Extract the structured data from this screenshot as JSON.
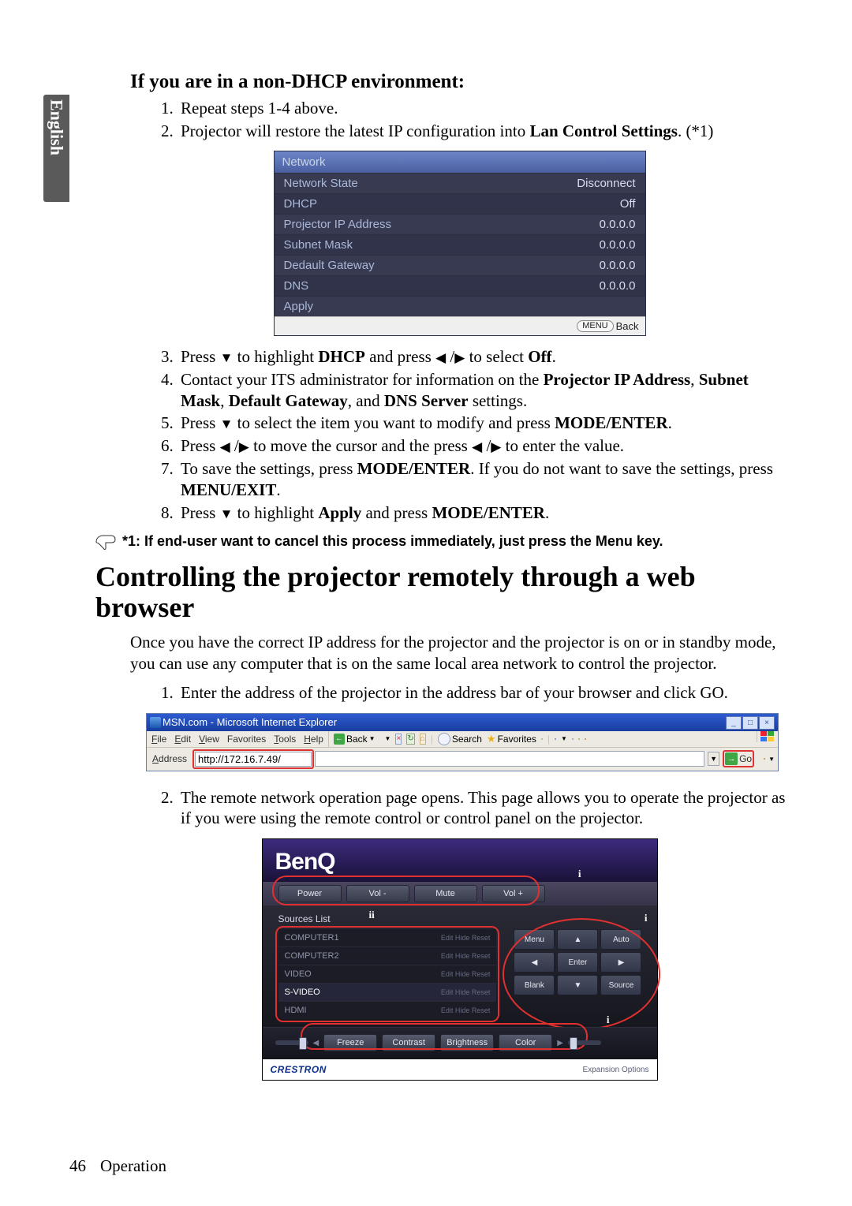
{
  "sidebar_language": "English",
  "section_nondhcp_title": "If you are in a non-DHCP environment:",
  "steps_a": {
    "s1": "Repeat steps 1-4 above.",
    "s2_pre": "Projector will restore the latest IP configuration into ",
    "s2_bold": "Lan Control Settings",
    "s2_post": ". (*1)"
  },
  "net_panel": {
    "title": "Network",
    "rows": [
      {
        "label": "Network State",
        "value": "Disconnect"
      },
      {
        "label": "DHCP",
        "value": "Off"
      },
      {
        "label": "Projector IP Address",
        "value": "0.0.0.0"
      },
      {
        "label": "Subnet Mask",
        "value": "0.0.0.0"
      },
      {
        "label": "Dedault Gateway",
        "value": "0.0.0.0"
      },
      {
        "label": "DNS",
        "value": "0.0.0.0"
      },
      {
        "label": "Apply",
        "value": ""
      }
    ],
    "footer_btn": "MENU",
    "footer_text": "Back"
  },
  "steps_b": {
    "s3_a": "Press ",
    "s3_b": " to highlight ",
    "s3_bold1": "DHCP",
    "s3_c": " and press ",
    "s3_d": " to select ",
    "s3_bold2": "Off",
    "s3_e": ".",
    "s4_a": "Contact your ITS administrator for information on the ",
    "s4_b1": "Projector IP Address",
    "s4_c": ", ",
    "s4_b2": "Subnet Mask",
    "s4_d": ", ",
    "s4_b3": "Default Gateway",
    "s4_e": ", and ",
    "s4_b4": "DNS Server",
    "s4_f": " settings.",
    "s5_a": "Press ",
    "s5_b": " to select the item you want to modify and press ",
    "s5_bold": "MODE/ENTER",
    "s5_c": ".",
    "s6_a": "Press ",
    "s6_b": " to move the cursor and the press ",
    "s6_c": " to enter the value.",
    "s7_a": "To save the settings, press ",
    "s7_b1": "MODE/ENTER",
    "s7_b": ". If you do not want to save the settings, press ",
    "s7_b2": "MENU/EXIT",
    "s7_c": ".",
    "s8_a": "Press ",
    "s8_b": " to highlight ",
    "s8_bold1": "Apply",
    "s8_c": " and press ",
    "s8_bold2": "MODE/ENTER",
    "s8_d": "."
  },
  "note_text": "*1: If end-user want to cancel this process immediately, just press the Menu key.",
  "h2_title": "Controlling the projector remotely through a web browser",
  "intro_para": "Once you have the correct IP address for the projector and the projector is on or in standby mode, you can use any computer that is on the same local area network to control the projector.",
  "steps_c": {
    "s1": "Enter the address of the projector in the address bar of your browser and click GO.",
    "s2": "The remote network operation page opens. This page allows you to operate the projector as if you were using the remote control or control panel on the projector."
  },
  "ie": {
    "title": "MSN.com - Microsoft Internet Explorer",
    "menus": [
      "File",
      "Edit",
      "View",
      "Favorites",
      "Tools",
      "Help"
    ],
    "back": "Back",
    "search": "Search",
    "favorites": "Favorites",
    "addr_label": "Address",
    "url": "http://172.16.7.49/",
    "go": "Go"
  },
  "benq": {
    "logo": "BenQ",
    "top_buttons": [
      "Power",
      "Vol -",
      "Mute",
      "Vol +"
    ],
    "sources_title": "Sources List",
    "sources": [
      {
        "name": "COMPUTER1",
        "acts": "Edit   Hide   Reset"
      },
      {
        "name": "COMPUTER2",
        "acts": "Edit   Hide   Reset"
      },
      {
        "name": "VIDEO",
        "acts": "Edit   Hide   Reset"
      },
      {
        "name": "S-VIDEO",
        "acts": "Edit   Hide   Reset",
        "sel": true
      },
      {
        "name": "HDMI",
        "acts": "Edit   Hide   Reset"
      }
    ],
    "dpad": {
      "menu": "Menu",
      "auto": "Auto",
      "enter": "Enter",
      "blank": "Blank",
      "source": "Source"
    },
    "bottom": [
      "Freeze",
      "Contrast",
      "Brightness",
      "Color"
    ],
    "crestron": "CRESTRON",
    "expansion": "Expansion Options",
    "callouts": {
      "i": "i",
      "ii": "ii"
    }
  },
  "footer": {
    "page": "46",
    "section": "Operation"
  }
}
